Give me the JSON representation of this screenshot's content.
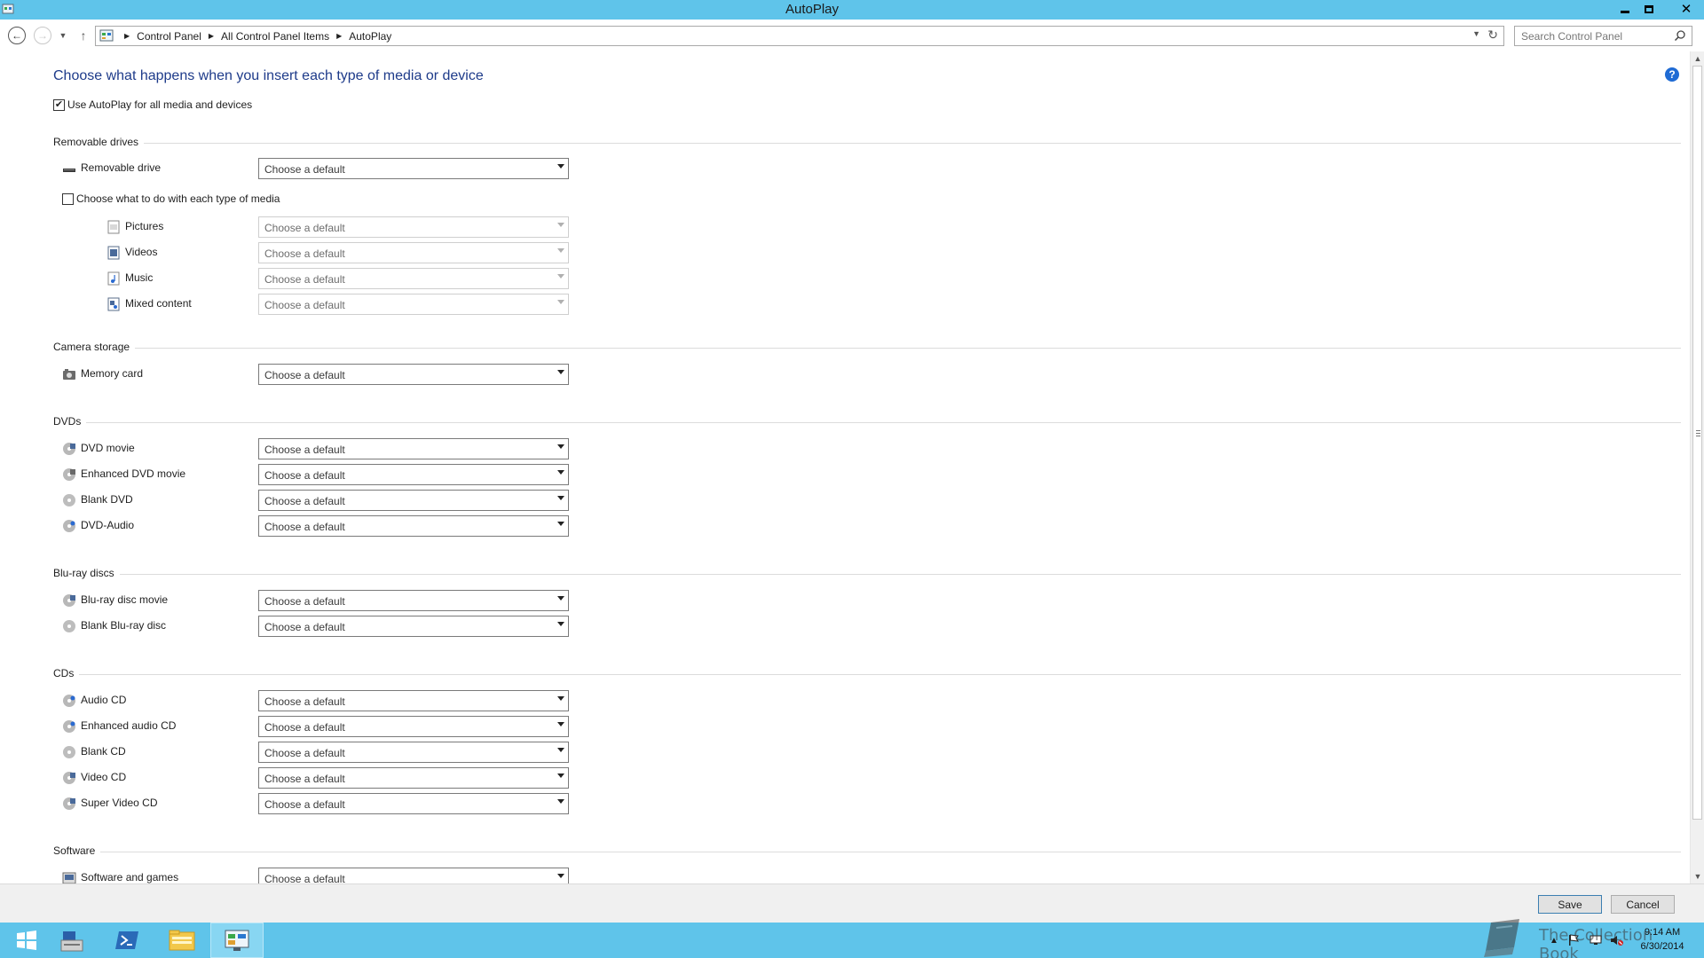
{
  "window": {
    "title": "AutoPlay",
    "controls": {
      "minimize": "minimize",
      "restore": "restore",
      "close": "✕"
    }
  },
  "nav": {
    "breadcrumbs": [
      "Control Panel",
      "All Control Panel Items",
      "AutoPlay"
    ],
    "search_placeholder": "Search Control Panel"
  },
  "page": {
    "heading": "Choose what happens when you insert each type of media or device",
    "use_autoplay_label": "Use AutoPlay for all media and devices",
    "use_autoplay_checked": true,
    "help_glyph": "?"
  },
  "sections": {
    "removable": {
      "title": "Removable drives",
      "removable_drive": {
        "label": "Removable drive",
        "value": "Choose a default",
        "icon": "removable-drive-icon"
      },
      "per_media_label": "Choose what to do with each type of media",
      "per_media_checked": false,
      "media": [
        {
          "label": "Pictures",
          "value": "Choose a default",
          "icon": "pictures-icon",
          "disabled": true
        },
        {
          "label": "Videos",
          "value": "Choose a default",
          "icon": "videos-icon",
          "disabled": true
        },
        {
          "label": "Music",
          "value": "Choose a default",
          "icon": "music-icon",
          "disabled": true
        },
        {
          "label": "Mixed content",
          "value": "Choose a default",
          "icon": "mixed-content-icon",
          "disabled": true
        }
      ]
    },
    "camera": {
      "title": "Camera storage",
      "items": [
        {
          "label": "Memory card",
          "value": "Choose a default",
          "icon": "memory-card-icon"
        }
      ]
    },
    "dvds": {
      "title": "DVDs",
      "items": [
        {
          "label": "DVD movie",
          "value": "Choose a default",
          "icon": "dvd-movie-icon"
        },
        {
          "label": "Enhanced DVD movie",
          "value": "Choose a default",
          "icon": "enhanced-dvd-icon"
        },
        {
          "label": "Blank DVD",
          "value": "Choose a default",
          "icon": "blank-dvd-icon"
        },
        {
          "label": "DVD-Audio",
          "value": "Choose a default",
          "icon": "dvd-audio-icon"
        }
      ]
    },
    "bluray": {
      "title": "Blu-ray discs",
      "items": [
        {
          "label": "Blu-ray disc movie",
          "value": "Choose a default",
          "icon": "bluray-movie-icon"
        },
        {
          "label": "Blank Blu-ray disc",
          "value": "Choose a default",
          "icon": "blank-bluray-icon"
        }
      ]
    },
    "cds": {
      "title": "CDs",
      "items": [
        {
          "label": "Audio CD",
          "value": "Choose a default",
          "icon": "audio-cd-icon"
        },
        {
          "label": "Enhanced audio CD",
          "value": "Choose a default",
          "icon": "enhanced-audio-cd-icon"
        },
        {
          "label": "Blank CD",
          "value": "Choose a default",
          "icon": "blank-cd-icon"
        },
        {
          "label": "Video CD",
          "value": "Choose a default",
          "icon": "video-cd-icon"
        },
        {
          "label": "Super Video CD",
          "value": "Choose a default",
          "icon": "super-video-cd-icon"
        }
      ]
    },
    "software": {
      "title": "Software",
      "items": [
        {
          "label": "Software and games",
          "value": "Choose a default",
          "icon": "software-games-icon"
        }
      ]
    }
  },
  "footer": {
    "save_label": "Save",
    "cancel_label": "Cancel"
  },
  "taskbar": {
    "items": [
      "start-icon",
      "server-manager-icon",
      "powershell-icon",
      "file-explorer-icon",
      "control-panel-icon"
    ],
    "clock_time": "9:14 AM",
    "clock_date": "6/30/2014"
  },
  "watermark": {
    "text": "The Collection Book"
  },
  "colors": {
    "titlebar": "#5fc4ea",
    "heading": "#1e3b8a",
    "help": "#1f6bd4"
  }
}
